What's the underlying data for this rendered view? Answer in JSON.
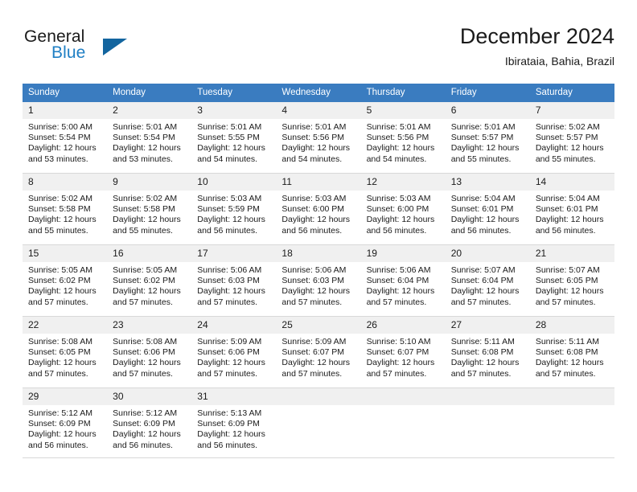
{
  "brand": {
    "word_general": "General",
    "word_blue": "Blue",
    "accent_color": "#1f7fc4",
    "triangle_color": "#13659f"
  },
  "header": {
    "month_title": "December 2024",
    "location": "Ibirataia, Bahia, Brazil"
  },
  "calendar": {
    "header_bg": "#3a7cc0",
    "daynum_bg": "#f0f0f0",
    "weekdays": [
      "Sunday",
      "Monday",
      "Tuesday",
      "Wednesday",
      "Thursday",
      "Friday",
      "Saturday"
    ],
    "weeks": [
      [
        {
          "day": "1",
          "sunrise": "Sunrise: 5:00 AM",
          "sunset": "Sunset: 5:54 PM",
          "daylight1": "Daylight: 12 hours",
          "daylight2": "and 53 minutes."
        },
        {
          "day": "2",
          "sunrise": "Sunrise: 5:01 AM",
          "sunset": "Sunset: 5:54 PM",
          "daylight1": "Daylight: 12 hours",
          "daylight2": "and 53 minutes."
        },
        {
          "day": "3",
          "sunrise": "Sunrise: 5:01 AM",
          "sunset": "Sunset: 5:55 PM",
          "daylight1": "Daylight: 12 hours",
          "daylight2": "and 54 minutes."
        },
        {
          "day": "4",
          "sunrise": "Sunrise: 5:01 AM",
          "sunset": "Sunset: 5:56 PM",
          "daylight1": "Daylight: 12 hours",
          "daylight2": "and 54 minutes."
        },
        {
          "day": "5",
          "sunrise": "Sunrise: 5:01 AM",
          "sunset": "Sunset: 5:56 PM",
          "daylight1": "Daylight: 12 hours",
          "daylight2": "and 54 minutes."
        },
        {
          "day": "6",
          "sunrise": "Sunrise: 5:01 AM",
          "sunset": "Sunset: 5:57 PM",
          "daylight1": "Daylight: 12 hours",
          "daylight2": "and 55 minutes."
        },
        {
          "day": "7",
          "sunrise": "Sunrise: 5:02 AM",
          "sunset": "Sunset: 5:57 PM",
          "daylight1": "Daylight: 12 hours",
          "daylight2": "and 55 minutes."
        }
      ],
      [
        {
          "day": "8",
          "sunrise": "Sunrise: 5:02 AM",
          "sunset": "Sunset: 5:58 PM",
          "daylight1": "Daylight: 12 hours",
          "daylight2": "and 55 minutes."
        },
        {
          "day": "9",
          "sunrise": "Sunrise: 5:02 AM",
          "sunset": "Sunset: 5:58 PM",
          "daylight1": "Daylight: 12 hours",
          "daylight2": "and 55 minutes."
        },
        {
          "day": "10",
          "sunrise": "Sunrise: 5:03 AM",
          "sunset": "Sunset: 5:59 PM",
          "daylight1": "Daylight: 12 hours",
          "daylight2": "and 56 minutes."
        },
        {
          "day": "11",
          "sunrise": "Sunrise: 5:03 AM",
          "sunset": "Sunset: 6:00 PM",
          "daylight1": "Daylight: 12 hours",
          "daylight2": "and 56 minutes."
        },
        {
          "day": "12",
          "sunrise": "Sunrise: 5:03 AM",
          "sunset": "Sunset: 6:00 PM",
          "daylight1": "Daylight: 12 hours",
          "daylight2": "and 56 minutes."
        },
        {
          "day": "13",
          "sunrise": "Sunrise: 5:04 AM",
          "sunset": "Sunset: 6:01 PM",
          "daylight1": "Daylight: 12 hours",
          "daylight2": "and 56 minutes."
        },
        {
          "day": "14",
          "sunrise": "Sunrise: 5:04 AM",
          "sunset": "Sunset: 6:01 PM",
          "daylight1": "Daylight: 12 hours",
          "daylight2": "and 56 minutes."
        }
      ],
      [
        {
          "day": "15",
          "sunrise": "Sunrise: 5:05 AM",
          "sunset": "Sunset: 6:02 PM",
          "daylight1": "Daylight: 12 hours",
          "daylight2": "and 57 minutes."
        },
        {
          "day": "16",
          "sunrise": "Sunrise: 5:05 AM",
          "sunset": "Sunset: 6:02 PM",
          "daylight1": "Daylight: 12 hours",
          "daylight2": "and 57 minutes."
        },
        {
          "day": "17",
          "sunrise": "Sunrise: 5:06 AM",
          "sunset": "Sunset: 6:03 PM",
          "daylight1": "Daylight: 12 hours",
          "daylight2": "and 57 minutes."
        },
        {
          "day": "18",
          "sunrise": "Sunrise: 5:06 AM",
          "sunset": "Sunset: 6:03 PM",
          "daylight1": "Daylight: 12 hours",
          "daylight2": "and 57 minutes."
        },
        {
          "day": "19",
          "sunrise": "Sunrise: 5:06 AM",
          "sunset": "Sunset: 6:04 PM",
          "daylight1": "Daylight: 12 hours",
          "daylight2": "and 57 minutes."
        },
        {
          "day": "20",
          "sunrise": "Sunrise: 5:07 AM",
          "sunset": "Sunset: 6:04 PM",
          "daylight1": "Daylight: 12 hours",
          "daylight2": "and 57 minutes."
        },
        {
          "day": "21",
          "sunrise": "Sunrise: 5:07 AM",
          "sunset": "Sunset: 6:05 PM",
          "daylight1": "Daylight: 12 hours",
          "daylight2": "and 57 minutes."
        }
      ],
      [
        {
          "day": "22",
          "sunrise": "Sunrise: 5:08 AM",
          "sunset": "Sunset: 6:05 PM",
          "daylight1": "Daylight: 12 hours",
          "daylight2": "and 57 minutes."
        },
        {
          "day": "23",
          "sunrise": "Sunrise: 5:08 AM",
          "sunset": "Sunset: 6:06 PM",
          "daylight1": "Daylight: 12 hours",
          "daylight2": "and 57 minutes."
        },
        {
          "day": "24",
          "sunrise": "Sunrise: 5:09 AM",
          "sunset": "Sunset: 6:06 PM",
          "daylight1": "Daylight: 12 hours",
          "daylight2": "and 57 minutes."
        },
        {
          "day": "25",
          "sunrise": "Sunrise: 5:09 AM",
          "sunset": "Sunset: 6:07 PM",
          "daylight1": "Daylight: 12 hours",
          "daylight2": "and 57 minutes."
        },
        {
          "day": "26",
          "sunrise": "Sunrise: 5:10 AM",
          "sunset": "Sunset: 6:07 PM",
          "daylight1": "Daylight: 12 hours",
          "daylight2": "and 57 minutes."
        },
        {
          "day": "27",
          "sunrise": "Sunrise: 5:11 AM",
          "sunset": "Sunset: 6:08 PM",
          "daylight1": "Daylight: 12 hours",
          "daylight2": "and 57 minutes."
        },
        {
          "day": "28",
          "sunrise": "Sunrise: 5:11 AM",
          "sunset": "Sunset: 6:08 PM",
          "daylight1": "Daylight: 12 hours",
          "daylight2": "and 57 minutes."
        }
      ],
      [
        {
          "day": "29",
          "sunrise": "Sunrise: 5:12 AM",
          "sunset": "Sunset: 6:09 PM",
          "daylight1": "Daylight: 12 hours",
          "daylight2": "and 56 minutes."
        },
        {
          "day": "30",
          "sunrise": "Sunrise: 5:12 AM",
          "sunset": "Sunset: 6:09 PM",
          "daylight1": "Daylight: 12 hours",
          "daylight2": "and 56 minutes."
        },
        {
          "day": "31",
          "sunrise": "Sunrise: 5:13 AM",
          "sunset": "Sunset: 6:09 PM",
          "daylight1": "Daylight: 12 hours",
          "daylight2": "and 56 minutes."
        },
        {
          "day": "",
          "sunrise": "",
          "sunset": "",
          "daylight1": "",
          "daylight2": ""
        },
        {
          "day": "",
          "sunrise": "",
          "sunset": "",
          "daylight1": "",
          "daylight2": ""
        },
        {
          "day": "",
          "sunrise": "",
          "sunset": "",
          "daylight1": "",
          "daylight2": ""
        },
        {
          "day": "",
          "sunrise": "",
          "sunset": "",
          "daylight1": "",
          "daylight2": ""
        }
      ]
    ]
  }
}
